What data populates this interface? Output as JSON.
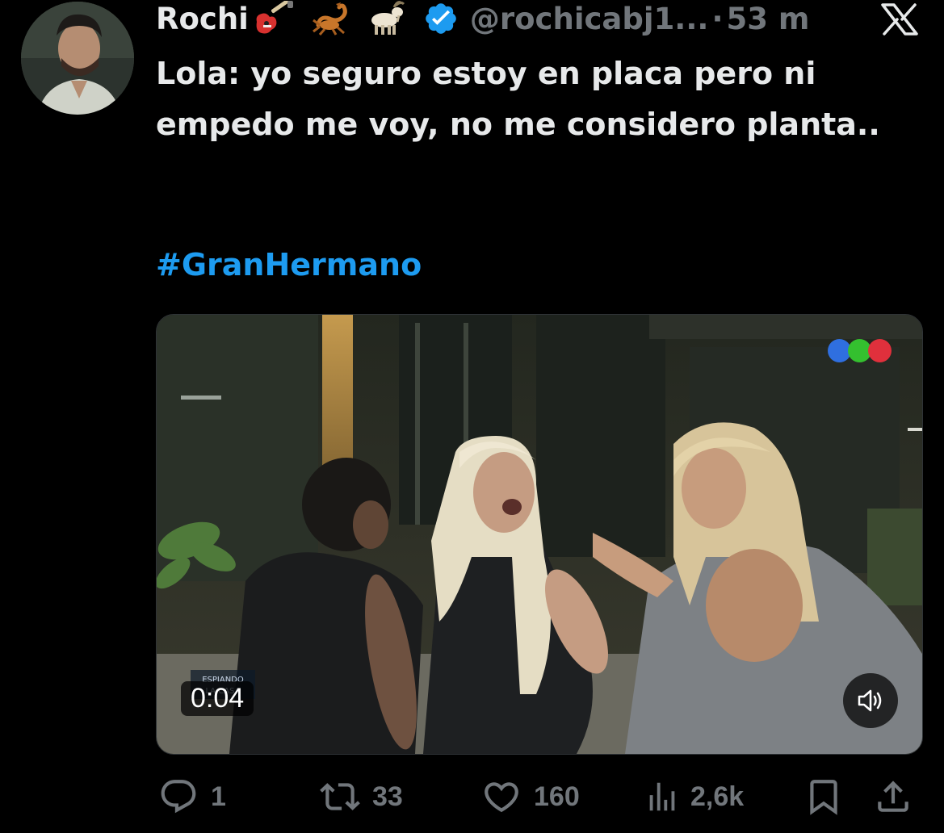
{
  "tweet": {
    "display_name": "Rochi",
    "name_emojis": [
      "guitar",
      "scorpion",
      "goat"
    ],
    "handle": "@rochicabj1...",
    "separator": "·",
    "time_ago": "53 m",
    "text": "Lola: yo seguro estoy en placa pero ni empedo me voy, no me considero planta..",
    "hashtag": "#GranHermano"
  },
  "media": {
    "duration": "0:04",
    "channel_dot_colors": [
      "#2f6fe0",
      "#34c02f",
      "#e0303c"
    ],
    "overlay_logo_text": "ESPIANDO LA CASA"
  },
  "actions": {
    "reply_count": "1",
    "retweet_count": "33",
    "like_count": "160",
    "views_count": "2,6k"
  },
  "colors": {
    "background": "#000000",
    "text_primary": "#e7e9ea",
    "text_secondary": "#71767b",
    "accent": "#1d9bf0"
  },
  "icons": [
    "verified-badge-icon",
    "x-logo-icon",
    "volume-icon",
    "reply-icon",
    "retweet-icon",
    "like-icon",
    "views-icon",
    "bookmark-icon",
    "share-icon"
  ]
}
